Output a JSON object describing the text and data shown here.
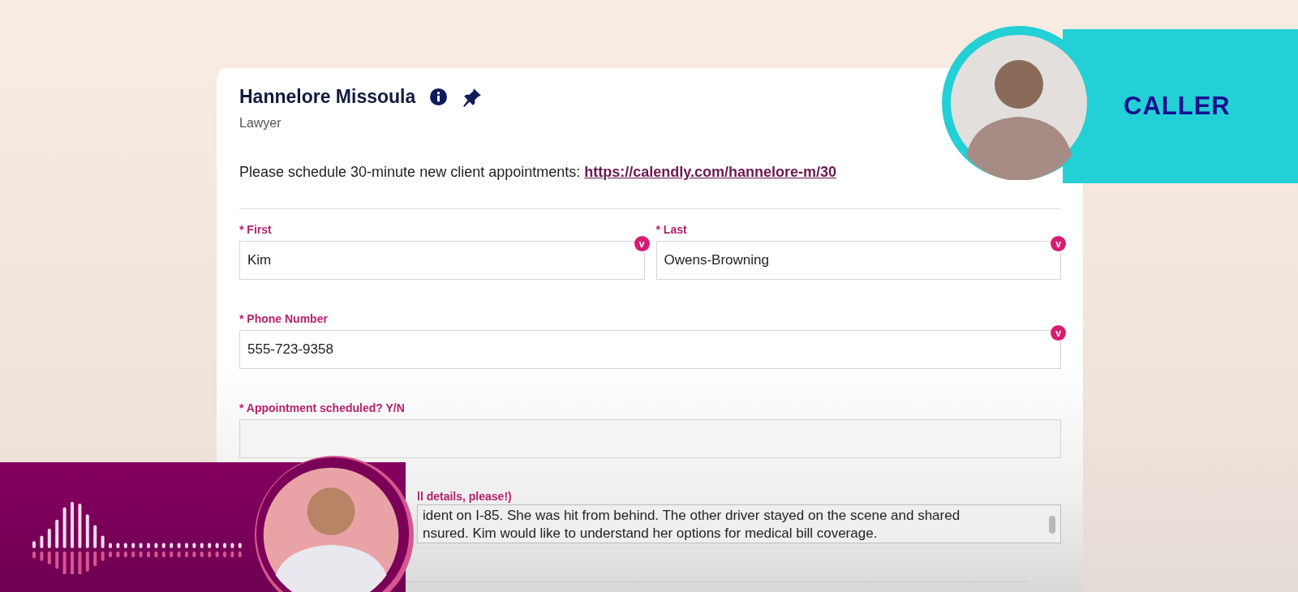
{
  "contact": {
    "name": "Hannelore Missoula",
    "role": "Lawyer",
    "instruction": "Please schedule 30-minute new client appointments: ",
    "link": "https://calendly.com/hannelore-m/30"
  },
  "fields": [
    {
      "label": "* First",
      "value": "Kim",
      "badge": "v",
      "kind": "half"
    },
    {
      "label": "* Last",
      "value": "Owens-Browning",
      "badge": "v",
      "kind": "half"
    },
    {
      "label": "* Phone Number",
      "value": "555-723-9358",
      "badge": "v",
      "kind": "full"
    },
    {
      "label": "* Appointment scheduled? Y/N",
      "kind": "full"
    }
  ],
  "notes": {
    "label": "ll details, please!)",
    "lines": [
      "ident on I-85. She was hit from behind. The other driver stayed on the scene and shared",
      "nsured. Kim would like to understand her options for medical bill coverage."
    ]
  },
  "caller_banner": {
    "label": "CALLER"
  }
}
